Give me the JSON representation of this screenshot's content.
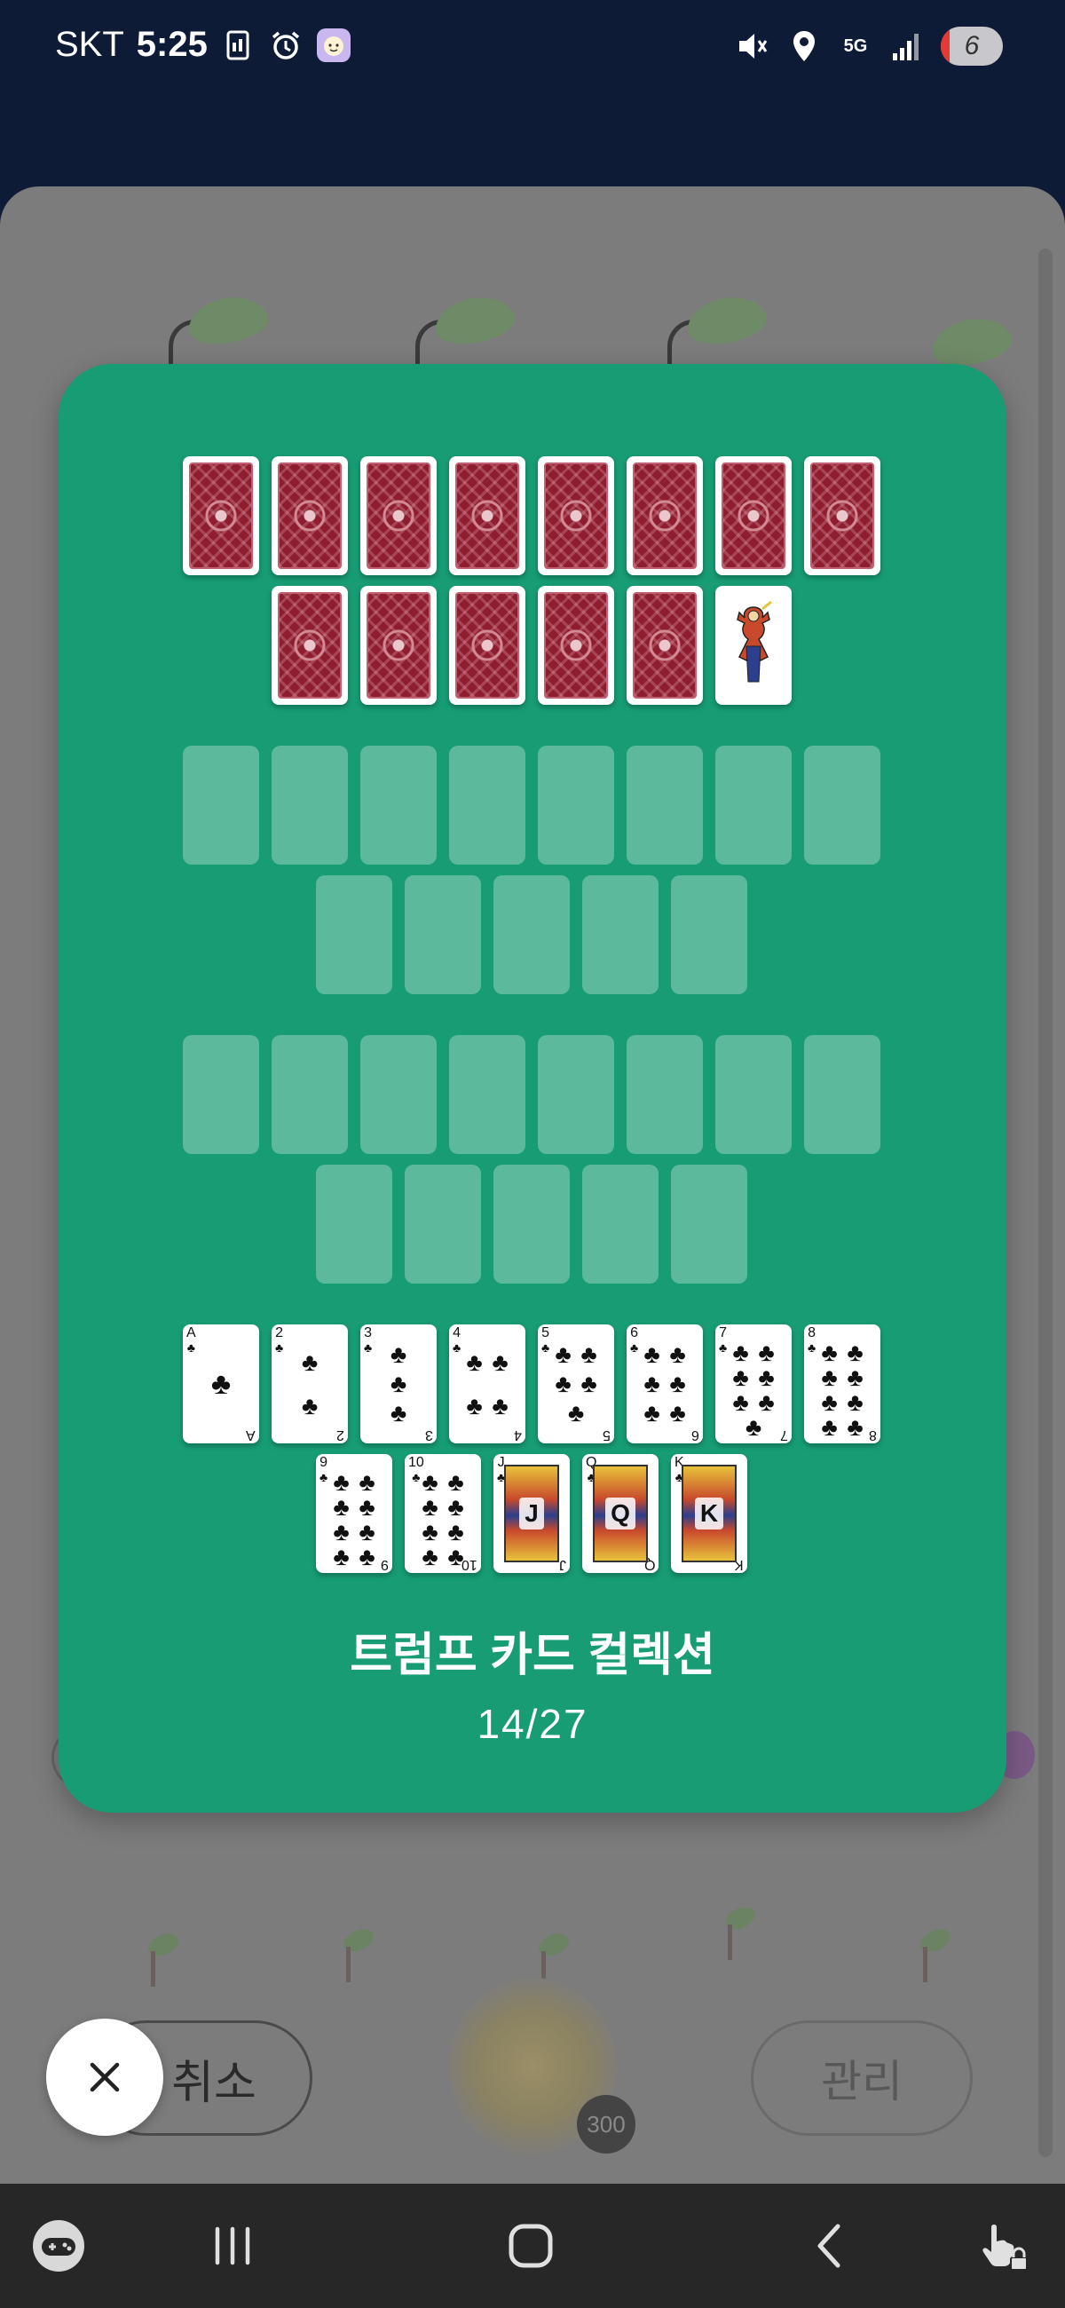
{
  "status_bar": {
    "carrier": "SKT",
    "time": "5:25",
    "network": "5G",
    "battery_level": "6",
    "icons": [
      "sim-card-icon",
      "alarm-icon",
      "face-app-icon",
      "mute-icon",
      "location-icon",
      "network-5g-icon",
      "signal-icon",
      "battery-icon"
    ]
  },
  "background_app": {
    "cancel_label": "취소",
    "manage_label": "관리",
    "points": "300"
  },
  "modal": {
    "title": "트럼프 카드 컬렉션",
    "progress": "14/27",
    "collected_count": 14,
    "total_count": 27,
    "colors": {
      "card_bg": "#179c74",
      "empty_slot": "#5cb99c",
      "card_back": "#8f1d30"
    },
    "rows": [
      {
        "state": "back",
        "count": 8
      },
      {
        "state": "back",
        "count": 5,
        "extra": "joker"
      },
      {
        "state": "empty",
        "count": 8
      },
      {
        "state": "empty",
        "count": 5
      },
      {
        "state": "empty",
        "count": 8
      },
      {
        "state": "empty",
        "count": 5
      },
      {
        "state": "clubs",
        "cards": [
          "A",
          "2",
          "3",
          "4",
          "5",
          "6",
          "7",
          "8"
        ]
      },
      {
        "state": "clubs",
        "cards": [
          "9",
          "10",
          "J",
          "Q",
          "K"
        ]
      }
    ],
    "suit_symbol": "♣"
  },
  "close_button": {
    "icon": "close-icon"
  },
  "nav_bar": {
    "buttons": [
      "game-controller-icon",
      "recent-apps-icon",
      "home-icon",
      "back-icon",
      "touch-lock-icon"
    ]
  }
}
